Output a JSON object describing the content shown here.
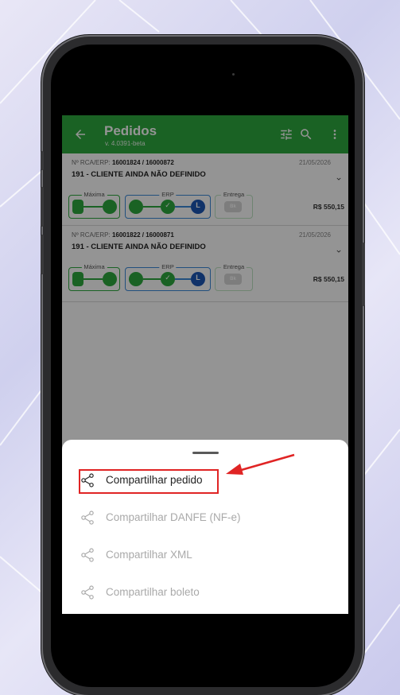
{
  "app": {
    "title": "Pedidos",
    "version": "v. 4.0391-beta"
  },
  "orders": [
    {
      "meta_prefix": "Nº RCA/ERP: ",
      "meta_ids": "16001824 / 16000872",
      "date": "21/05/2026",
      "client": "191 - CLIENTE AINDA NÃO DEFINIDO",
      "amount": "R$ 550,15",
      "group_labels": [
        "Máxima",
        "ERP",
        "Entrega"
      ]
    },
    {
      "meta_prefix": "Nº RCA/ERP: ",
      "meta_ids": "16001822 / 16000871",
      "date": "21/05/2026",
      "client": "191 - CLIENTE AINDA NÃO DEFINIDO",
      "amount": "R$ 550,15",
      "group_labels": [
        "Máxima",
        "ERP",
        "Entrega"
      ]
    }
  ],
  "status_node_text": {
    "erp_final": "L",
    "entrega": "Bk"
  },
  "share_sheet": {
    "items": [
      {
        "label": "Compartilhar pedido",
        "enabled": true
      },
      {
        "label": "Compartilhar DANFE (NF-e)",
        "enabled": false
      },
      {
        "label": "Compartilhar XML",
        "enabled": false
      },
      {
        "label": "Compartilhar boleto",
        "enabled": false
      }
    ]
  },
  "icons": [
    "back-arrow-icon",
    "filter-icon",
    "search-icon",
    "more-vert-icon",
    "chevron-down-icon",
    "share-icon",
    "phone-icon",
    "cloud-icon",
    "store-icon",
    "check-icon"
  ],
  "colors": {
    "appbar": "#2eaa3e",
    "erp_border": "#3b8ad9",
    "erp_final_node": "#1d57b5",
    "highlight": "#e02424"
  }
}
